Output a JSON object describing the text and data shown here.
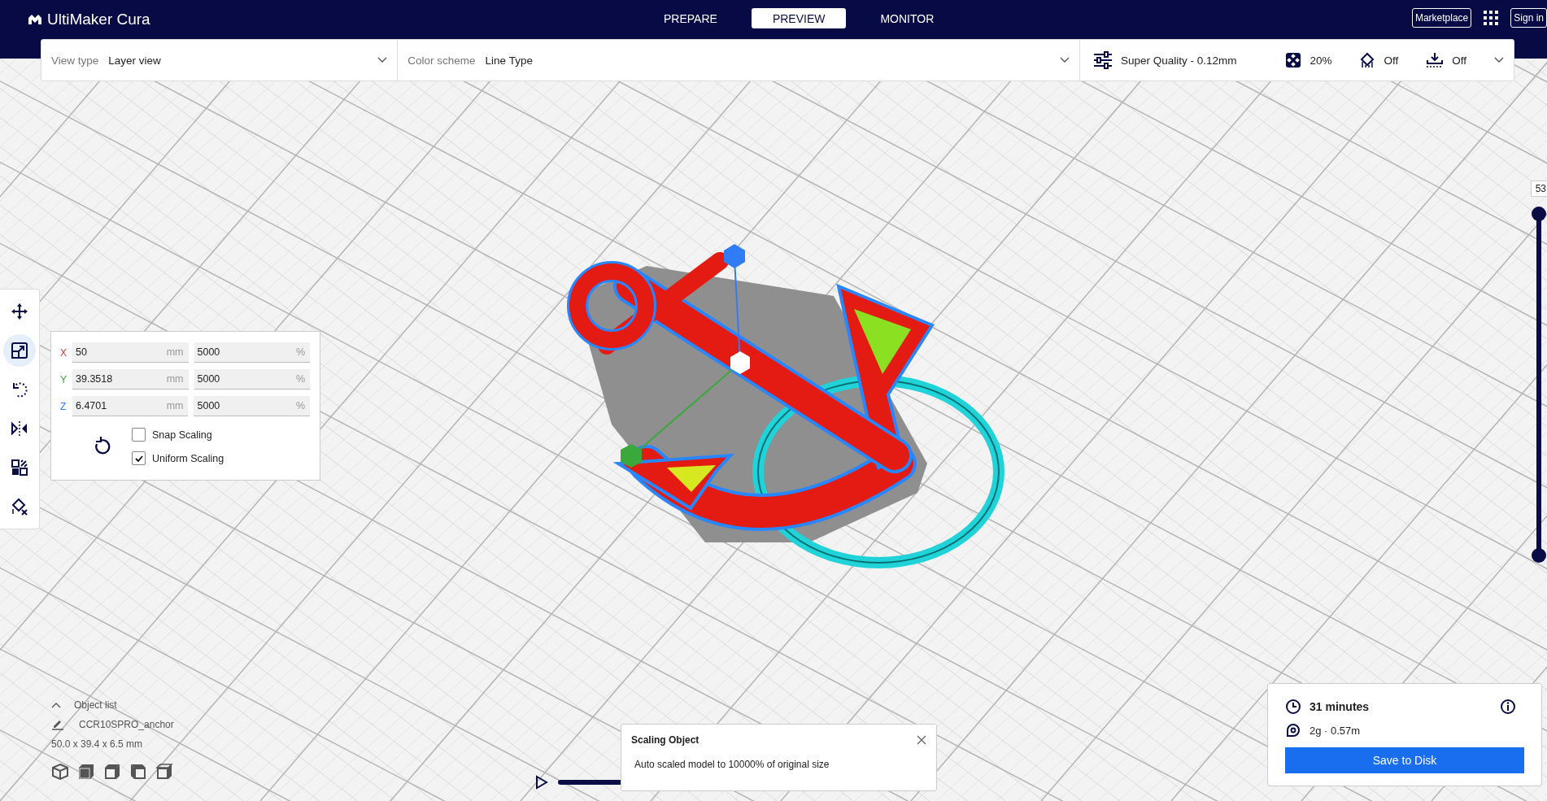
{
  "header": {
    "logo": "UltiMaker Cura",
    "tabs": [
      {
        "label": "PREPARE",
        "selected": false
      },
      {
        "label": "PREVIEW",
        "selected": true
      },
      {
        "label": "MONITOR",
        "selected": false
      }
    ],
    "marketplace": "Marketplace",
    "sign_in": "Sign in"
  },
  "view_bar": {
    "view_type": {
      "label": "View type",
      "value": "Layer view"
    },
    "color_scheme": {
      "label": "Color scheme",
      "value": "Line Type"
    },
    "profile": "Super Quality - 0.12mm",
    "infill": "20%",
    "support": "Off",
    "adhesion": "Off"
  },
  "tools": [
    {
      "kind": "move",
      "selected": false
    },
    {
      "kind": "scale",
      "selected": true
    },
    {
      "kind": "rotate",
      "selected": false
    },
    {
      "kind": "mirror",
      "selected": false
    },
    {
      "kind": "per-model",
      "selected": false
    },
    {
      "kind": "support-blocker",
      "selected": false
    }
  ],
  "scale_panel": {
    "axes": [
      {
        "axis": "X",
        "color": "#e53935",
        "mm": "50",
        "unit_mm": "mm",
        "percent": "5000",
        "unit_percent": "%"
      },
      {
        "axis": "Y",
        "color": "#3aa83a",
        "mm": "39.3518",
        "unit_mm": "mm",
        "percent": "5000",
        "unit_percent": "%"
      },
      {
        "axis": "Z",
        "color": "#2f7cf6",
        "mm": "6.4701",
        "unit_mm": "mm",
        "percent": "5000",
        "unit_percent": "%"
      }
    ],
    "options": [
      {
        "label": "Snap Scaling",
        "checked": false
      },
      {
        "label": "Uniform Scaling",
        "checked": true
      }
    ]
  },
  "layer_slider": {
    "label": "53",
    "level": 1
  },
  "object_list": {
    "title": "Object list",
    "object": "CCR10SPRO_anchor",
    "dimensions": "50.0 x 39.4 x 6.5 mm"
  },
  "view_cubes": [
    {
      "kind": "isometric"
    },
    {
      "kind": "front"
    },
    {
      "kind": "top"
    },
    {
      "kind": "left"
    },
    {
      "kind": "right"
    }
  ],
  "notification": {
    "title": "Scaling Object",
    "message": "Auto scaled model to 10000% of original size"
  },
  "print_info": {
    "time": "31 minutes",
    "material": "2g · 0.57m",
    "button": "Save to Disk"
  }
}
